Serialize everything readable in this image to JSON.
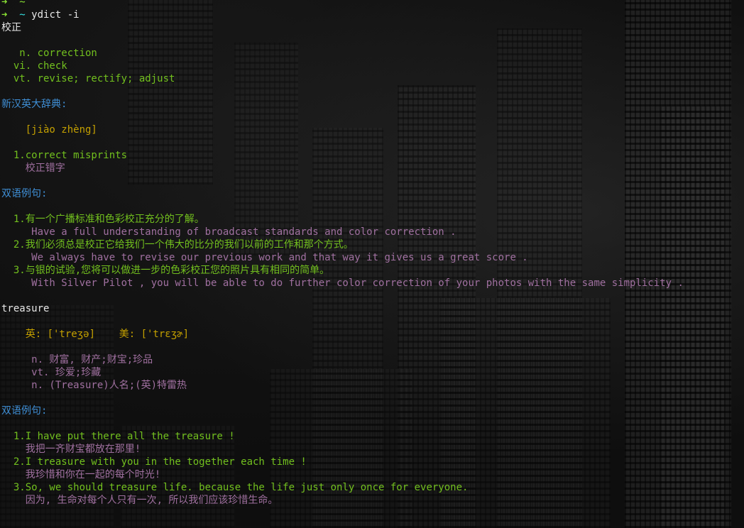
{
  "colors": {
    "prompt_arrow": "#8ae234",
    "prompt_dir": "#34e2e2",
    "text_default": "#e8e8e8",
    "definition_green": "#72c01e",
    "header_blue": "#3f8fd6",
    "translation_purple": "#a070a0",
    "pinyin_yellow": "#c4a000"
  },
  "lines": [
    {
      "segments": [
        {
          "text": "➜  ~",
          "color": "arrow"
        }
      ]
    },
    {
      "segments": [
        {
          "text": "➜  ",
          "color": "arrow"
        },
        {
          "text": "~ ",
          "color": "tilde"
        },
        {
          "text": "ydict -i",
          "color": "cmd"
        }
      ]
    },
    {
      "segments": [
        {
          "text": "校正",
          "color": "white"
        }
      ]
    },
    {
      "segments": []
    },
    {
      "segments": [
        {
          "text": "   n. correction",
          "color": "green"
        }
      ]
    },
    {
      "segments": [
        {
          "text": "  vi. check",
          "color": "green"
        }
      ]
    },
    {
      "segments": [
        {
          "text": "  vt. revise; rectify; adjust",
          "color": "green"
        }
      ]
    },
    {
      "segments": []
    },
    {
      "segments": [
        {
          "text": "新汉英大辞典:",
          "color": "blue"
        }
      ]
    },
    {
      "segments": []
    },
    {
      "segments": [
        {
          "text": "    [jiào zhèng]",
          "color": "yellow"
        }
      ]
    },
    {
      "segments": []
    },
    {
      "segments": [
        {
          "text": "  1.correct misprints",
          "color": "green"
        }
      ]
    },
    {
      "segments": [
        {
          "text": "    校正错字",
          "color": "purple"
        }
      ]
    },
    {
      "segments": []
    },
    {
      "segments": [
        {
          "text": "双语例句:",
          "color": "blue"
        }
      ]
    },
    {
      "segments": []
    },
    {
      "segments": [
        {
          "text": "  1.有一个广播标准和色彩校正充分的了解。",
          "color": "green"
        }
      ]
    },
    {
      "segments": [
        {
          "text": "     Have a full understanding of broadcast standards and color correction .",
          "color": "purple"
        }
      ]
    },
    {
      "segments": [
        {
          "text": "  2.我们必须总是校正它给我们一个伟大的比分的我们以前的工作和那个方式。",
          "color": "green"
        }
      ]
    },
    {
      "segments": [
        {
          "text": "     We always have to revise our previous work and that way it gives us a great score .",
          "color": "purple"
        }
      ]
    },
    {
      "segments": [
        {
          "text": "  3.与银的试验,您将可以做进一步的色彩校正您的照片具有相同的简单。",
          "color": "green"
        }
      ]
    },
    {
      "segments": [
        {
          "text": "     With Silver Pilot , you will be able to do further color correction of your photos with the same simplicity .",
          "color": "purple"
        }
      ]
    },
    {
      "segments": []
    },
    {
      "segments": [
        {
          "text": "treasure",
          "color": "white"
        }
      ]
    },
    {
      "segments": []
    },
    {
      "segments": [
        {
          "text": "    英: ['treʒə]    美: ['trɛʒɚ]",
          "color": "yellow"
        }
      ]
    },
    {
      "segments": []
    },
    {
      "segments": [
        {
          "text": "     n. 财富, 财产;财宝;珍品",
          "color": "purple"
        }
      ]
    },
    {
      "segments": [
        {
          "text": "     vt. 珍爱;珍藏",
          "color": "purple"
        }
      ]
    },
    {
      "segments": [
        {
          "text": "     n. (Treasure)人名;(英)特雷热",
          "color": "purple"
        }
      ]
    },
    {
      "segments": []
    },
    {
      "segments": [
        {
          "text": "双语例句:",
          "color": "blue"
        }
      ]
    },
    {
      "segments": []
    },
    {
      "segments": [
        {
          "text": "  1.I have put there all the treasure !",
          "color": "green"
        }
      ]
    },
    {
      "segments": [
        {
          "text": "    我把一齐财宝都放在那里!",
          "color": "purple"
        }
      ]
    },
    {
      "segments": [
        {
          "text": "  2.I treasure with you in the together each time !",
          "color": "green"
        }
      ]
    },
    {
      "segments": [
        {
          "text": "    我珍惜和你在一起的每个时光!",
          "color": "purple"
        }
      ]
    },
    {
      "segments": [
        {
          "text": "  3.So, we should treasure life. because the life just only once for everyone.",
          "color": "green"
        }
      ]
    },
    {
      "segments": [
        {
          "text": "    因为, 生命对每个人只有一次, 所以我们应该珍惜生命。",
          "color": "purple"
        }
      ]
    }
  ]
}
